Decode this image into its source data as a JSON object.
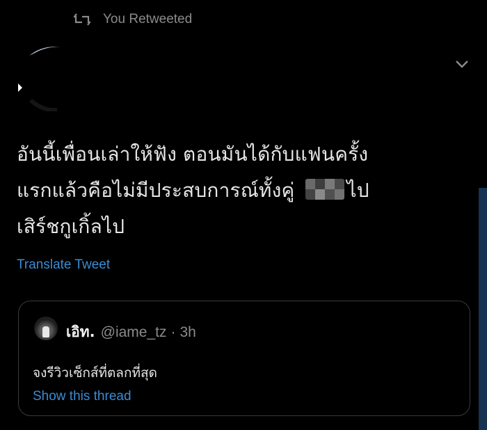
{
  "retweet": {
    "icon": "retweet-icon",
    "label": "You Retweeted"
  },
  "tweet": {
    "lines": [
      "อันนี้เพื่อนเล่าให้ฟัง ตอนมันได้กับแฟนครั้ง",
      "แรกแล้วคือไม่มีประสบการณ์ทั้งคู่",
      "ไป",
      "เสิร์ชกูเกิ้ลไป"
    ],
    "translate_label": "Translate Tweet",
    "menu_icon": "chevron-down-icon"
  },
  "quoted_tweet": {
    "name": "เอิท.",
    "handle": "@iame_tz",
    "separator": "·",
    "time": "3h",
    "text": "จงรีวิวเซ็กส์ที่ตลกที่สุด",
    "show_thread_label": "Show this thread"
  },
  "colors": {
    "background": "#000000",
    "link": "#3a8cd6",
    "muted": "#8b8b8b",
    "text": "#e6e6e6"
  }
}
